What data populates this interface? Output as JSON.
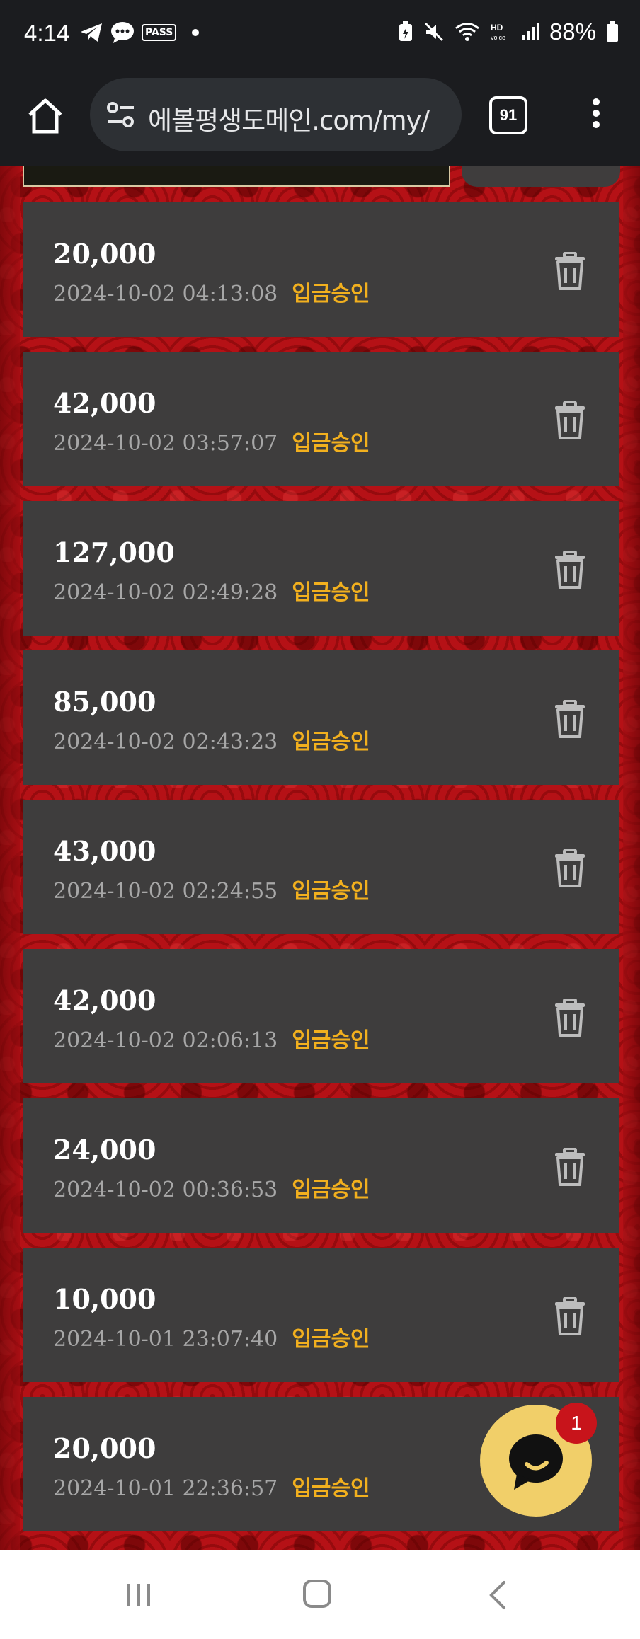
{
  "status_bar": {
    "time": "4:14",
    "left_icons": [
      "telegram-icon",
      "chat-message-icon",
      "pass-icon"
    ],
    "pass_label": "PASS",
    "battery_percent": "88%"
  },
  "browser": {
    "url": "에볼평생도메인.com/my/",
    "tab_count": "91"
  },
  "deposits": [
    {
      "amount": "20,000",
      "datetime": "2024-10-02 04:13:08",
      "status": "입금승인"
    },
    {
      "amount": "42,000",
      "datetime": "2024-10-02 03:57:07",
      "status": "입금승인"
    },
    {
      "amount": "127,000",
      "datetime": "2024-10-02 02:49:28",
      "status": "입금승인"
    },
    {
      "amount": "85,000",
      "datetime": "2024-10-02 02:43:23",
      "status": "입금승인"
    },
    {
      "amount": "43,000",
      "datetime": "2024-10-02 02:24:55",
      "status": "입금승인"
    },
    {
      "amount": "42,000",
      "datetime": "2024-10-02 02:06:13",
      "status": "입금승인"
    },
    {
      "amount": "24,000",
      "datetime": "2024-10-02 00:36:53",
      "status": "입금승인"
    },
    {
      "amount": "10,000",
      "datetime": "2024-10-01 23:07:40",
      "status": "입금승인"
    },
    {
      "amount": "20,000",
      "datetime": "2024-10-01 22:36:57",
      "status": "입금승인"
    }
  ],
  "chat": {
    "badge_count": "1"
  },
  "colors": {
    "background_red": "#b51116",
    "row_bg": "#3e3d3d",
    "status_yellow": "#f2b01e",
    "chat_yellow": "#f1cf69",
    "badge_red": "#c8141b"
  }
}
